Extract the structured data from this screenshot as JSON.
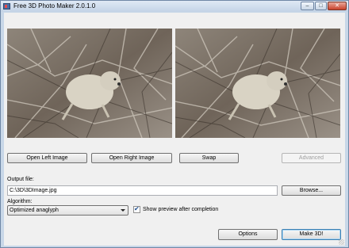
{
  "window": {
    "title": "Free 3D Photo Maker 2.0.1.0",
    "controls": {
      "minimize": "–",
      "maximize": "□",
      "close": "✕"
    }
  },
  "previews": {
    "left_image_alt": "Rock hyrax on tree branches (left image)",
    "right_image_alt": "Rock hyrax on tree branches (right image)"
  },
  "buttons": {
    "open_left": "Open Left Image",
    "open_right": "Open Right Image",
    "swap": "Swap",
    "advanced": "Advanced",
    "browse": "Browse...",
    "options": "Options",
    "make_3d": "Make 3D!"
  },
  "output": {
    "label": "Output file:",
    "value": "C:\\3D\\3DImage.jpg"
  },
  "algorithm": {
    "label": "Algorithm:",
    "selected": "Optimized anaglyph"
  },
  "preview_checkbox": {
    "checked": true,
    "label": "Show preview after completion"
  },
  "colors": {
    "window_frame": "#c8d7e8",
    "client_bg": "#f0f0f0",
    "default_button_border": "#3c7fb1"
  }
}
